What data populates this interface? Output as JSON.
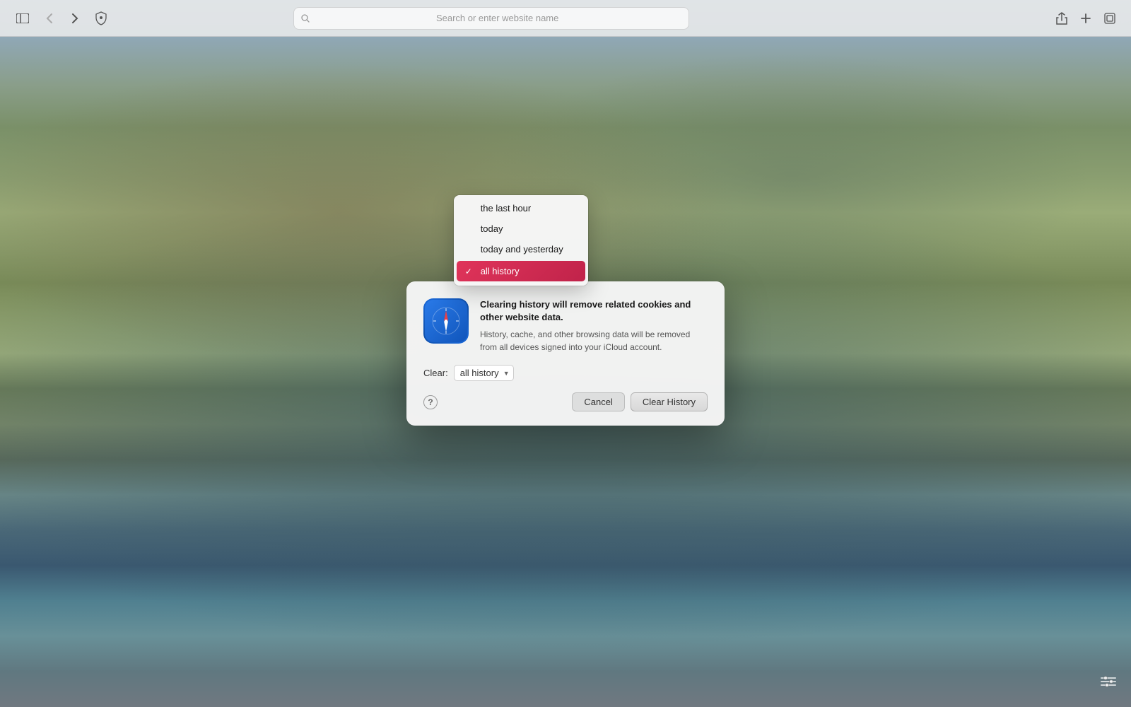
{
  "browser": {
    "toolbar": {
      "search_placeholder": "Search or enter website name",
      "back_icon": "‹",
      "forward_icon": "›",
      "sidebar_icon": "⊡",
      "share_icon": "↑",
      "new_tab_icon": "+",
      "tab_overview_icon": "⧉",
      "filter_icon": "≡"
    }
  },
  "dialog": {
    "title": "Clearing history will remove related cookies and other website data.",
    "body": "History, cache, and other browsing data will be removed from all devices signed into your iCloud account.",
    "clear_label": "Clear:",
    "safari_icon_label": "Safari",
    "dropdown": {
      "options": [
        {
          "value": "last_hour",
          "label": "the last hour",
          "selected": false
        },
        {
          "value": "today",
          "label": "today",
          "selected": false
        },
        {
          "value": "today_yesterday",
          "label": "today and yesterday",
          "selected": false
        },
        {
          "value": "all_history",
          "label": "all history",
          "selected": true
        }
      ]
    },
    "help_label": "?",
    "cancel_label": "Cancel",
    "confirm_label": "Clear History"
  }
}
